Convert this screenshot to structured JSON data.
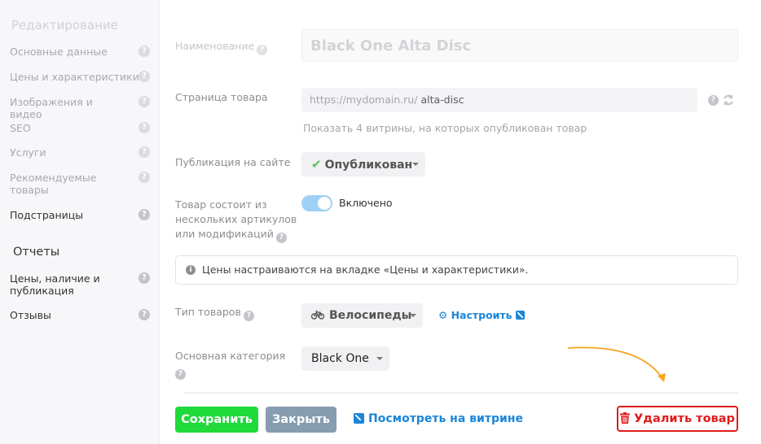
{
  "sidebar": {
    "title": "Редактирование",
    "items": [
      {
        "label": "Основные данные",
        "help": "?"
      },
      {
        "label": "Цены и характеристики",
        "help": "?"
      },
      {
        "label": "Изображения и видео",
        "help": "?"
      },
      {
        "label": "SEO",
        "help": "?"
      },
      {
        "label": "Услуги",
        "help": "?"
      },
      {
        "label": "Рекомендуемые товары",
        "help": "?"
      },
      {
        "label": "Подстраницы",
        "help": "?"
      }
    ],
    "reports_title": "Отчеты",
    "reports": [
      {
        "label": "Цены, наличие и публикация",
        "help": "?"
      },
      {
        "label": "Отзывы",
        "help": "?"
      }
    ]
  },
  "form": {
    "name_label": "Наименование",
    "name_value": "Black One Alta Disc",
    "page_label": "Страница товара",
    "url_base": "https://mydomain.ru/",
    "url_slug": "alta-disc",
    "storefronts_info": "Показать 4 витрины, на которых опубликован товар",
    "publication_label": "Публикация на сайте",
    "publication_value": "Опубликован",
    "variants_label": "Товар состоит из нескольких артикулов или модификаций",
    "variants_toggle": "Включено",
    "notice": "Цены настраиваются на вкладке «Цены и характеристики».",
    "type_label": "Тип товаров",
    "type_value": "Велосипеды",
    "configure_link": "Настроить",
    "category_label": "Основная категория",
    "category_value": "Black One"
  },
  "footer": {
    "save": "Сохранить",
    "close": "Закрыть",
    "view": "Посмотреть на витрине",
    "delete": "Удалить товар"
  },
  "colors": {
    "save": "#20d93a",
    "close": "#869cb0",
    "link": "#1a86d8",
    "delete": "#e11b1b",
    "arrow": "#f5a41c"
  }
}
